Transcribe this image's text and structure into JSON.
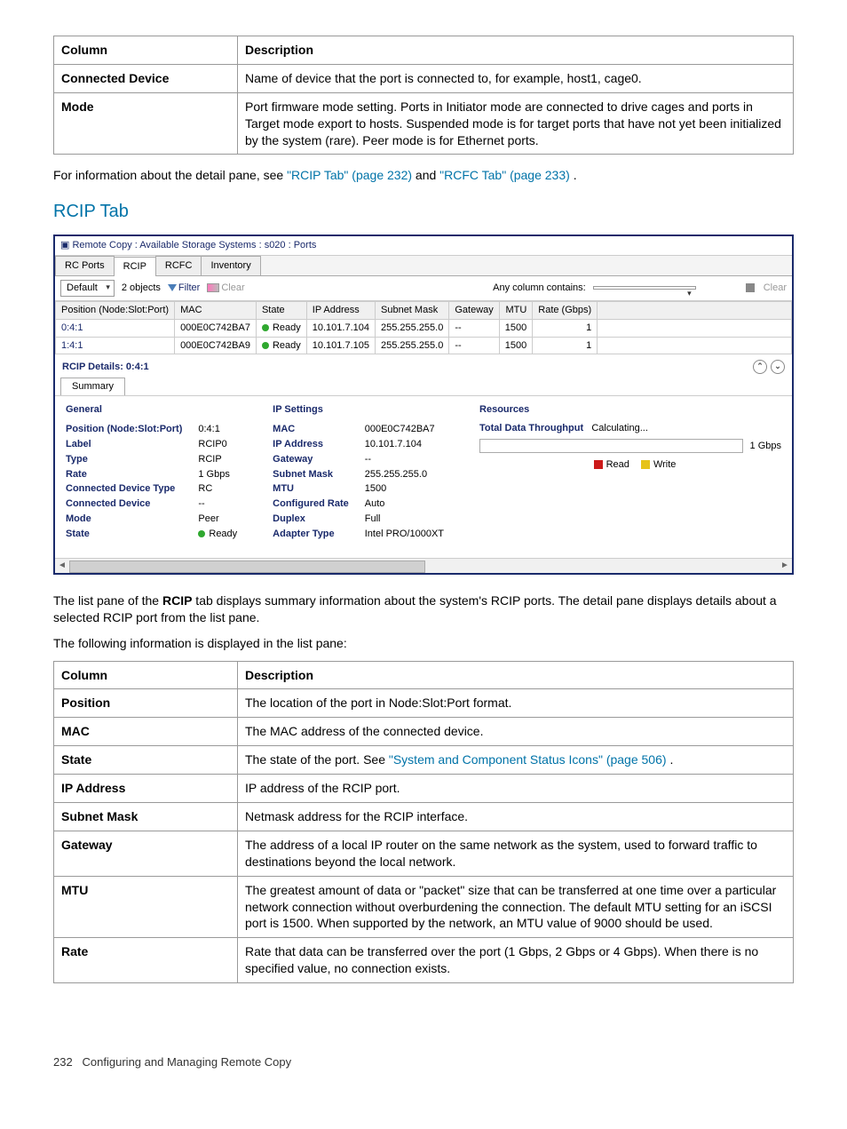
{
  "topTable": {
    "headers": [
      "Column",
      "Description"
    ],
    "rows": [
      {
        "col": "Connected Device",
        "desc": "Name of device that the port is connected to, for example, host1, cage0."
      },
      {
        "col": "Mode",
        "desc": "Port firmware mode setting. Ports in Initiator mode are connected to drive cages and ports in Target mode export to hosts. Suspended mode is for target ports that have not yet been initialized by the system (rare). Peer mode is for Ethernet ports."
      }
    ]
  },
  "introLine": {
    "prefix": "For information about the detail pane, see ",
    "link1": "\"RCIP Tab\" (page 232)",
    "mid": " and ",
    "link2": "\"RCFC Tab\" (page 233)",
    "suffix": "."
  },
  "sectionTitle": "RCIP Tab",
  "app": {
    "title": "Remote Copy : Available Storage Systems : s020 : Ports",
    "tabs": [
      "RC Ports",
      "RCIP",
      "RCFC",
      "Inventory"
    ],
    "activeTab": "RCIP",
    "toolbar": {
      "dropdown": "Default",
      "objects": "2 objects",
      "filter": "Filter",
      "clear": "Clear",
      "searchLabel": "Any column contains:",
      "searchValue": "",
      "clearRight": "Clear"
    },
    "gridHeaders": [
      "Position (Node:Slot:Port)",
      "MAC",
      "State",
      "IP Address",
      "Subnet Mask",
      "Gateway",
      "MTU",
      "Rate (Gbps)"
    ],
    "gridRows": [
      {
        "pos": "0:4:1",
        "mac": "000E0C742BA7",
        "state": "Ready",
        "ip": "10.101.7.104",
        "mask": "255.255.255.0",
        "gw": "--",
        "mtu": "1500",
        "rate": "1"
      },
      {
        "pos": "1:4:1",
        "mac": "000E0C742BA9",
        "state": "Ready",
        "ip": "10.101.7.105",
        "mask": "255.255.255.0",
        "gw": "--",
        "mtu": "1500",
        "rate": "1"
      }
    ],
    "detailTitle": "RCIP Details: 0:4:1",
    "innerTab": "Summary",
    "general": {
      "title": "General",
      "rows": [
        [
          "Position (Node:Slot:Port)",
          "0:4:1"
        ],
        [
          "Label",
          "RCIP0"
        ],
        [
          "Type",
          "RCIP"
        ],
        [
          "Rate",
          "1 Gbps"
        ],
        [
          "Connected Device Type",
          "RC"
        ],
        [
          "Connected Device",
          "--"
        ],
        [
          "Mode",
          "Peer"
        ],
        [
          "State",
          "Ready"
        ]
      ]
    },
    "ipSettings": {
      "title": "IP Settings",
      "rows": [
        [
          "MAC",
          "000E0C742BA7"
        ],
        [
          "IP Address",
          "10.101.7.104"
        ],
        [
          "Gateway",
          "--"
        ],
        [
          "Subnet Mask",
          "255.255.255.0"
        ],
        [
          "MTU",
          "1500"
        ],
        [
          "Configured Rate",
          "Auto"
        ],
        [
          "Duplex",
          "Full"
        ],
        [
          "Adapter Type",
          "Intel PRO/1000XT"
        ]
      ]
    },
    "resources": {
      "title": "Resources",
      "throughputLabel": "Total Data Throughput",
      "throughputValue": "Calculating...",
      "unit": "1 Gbps",
      "legendRead": "Read",
      "legendWrite": "Write"
    }
  },
  "afterPara1": {
    "t1": "The list pane of the ",
    "b": "RCIP",
    "t2": " tab displays summary information about the system's RCIP ports. The detail pane displays details about a selected RCIP port from the list pane."
  },
  "afterPara2": "The following information is displayed in the list pane:",
  "bottomTable": {
    "headers": [
      "Column",
      "Description"
    ],
    "rows": [
      {
        "col": "Position",
        "desc": "The location of the port in Node:Slot:Port format."
      },
      {
        "col": "MAC",
        "desc": "The MAC address of the connected device."
      },
      {
        "col": "State",
        "descPrefix": "The state of the port. See ",
        "link": "\"System and Component Status Icons\" (page 506)",
        "descSuffix": "."
      },
      {
        "col": "IP Address",
        "desc": "IP address of the RCIP port."
      },
      {
        "col": "Subnet Mask",
        "desc": "Netmask address for the RCIP interface."
      },
      {
        "col": "Gateway",
        "desc": "The address of a local IP router on the same network as the system, used to forward traffic to destinations beyond the local network."
      },
      {
        "col": "MTU",
        "desc": "The greatest amount of data or \"packet\" size that can be transferred at one time over a particular network connection without overburdening the connection. The default MTU setting for an iSCSI port is 1500. When supported by the network, an MTU value of 9000 should be used."
      },
      {
        "col": "Rate",
        "desc": "Rate that data can be transferred over the port (1 Gbps, 2 Gbps or 4 Gbps). When there is no specified value, no connection exists."
      }
    ]
  },
  "footer": {
    "page": "232",
    "text": "Configuring and Managing Remote Copy"
  }
}
